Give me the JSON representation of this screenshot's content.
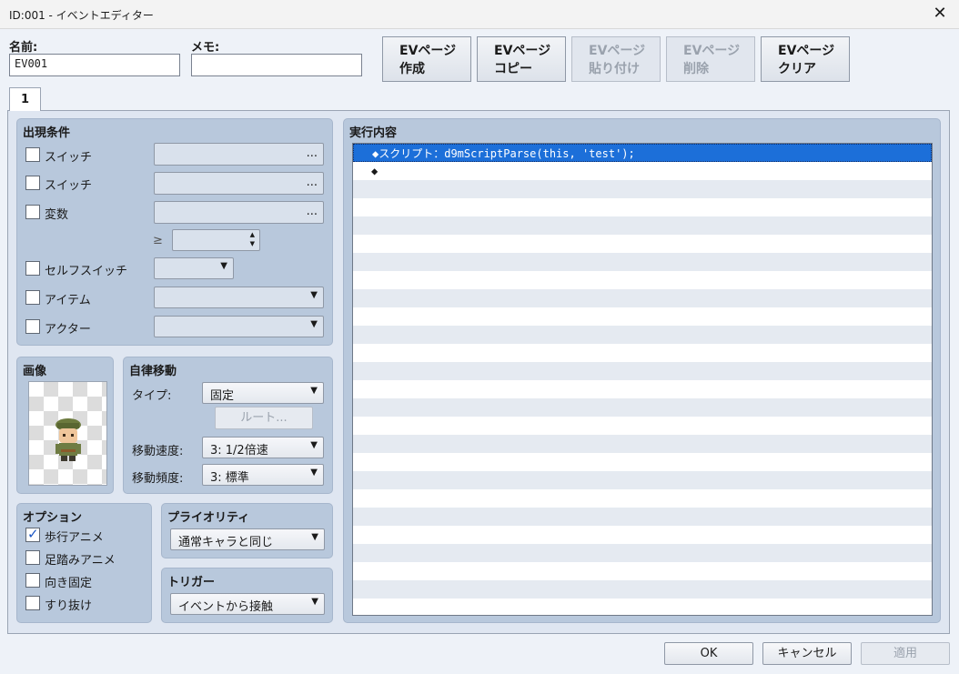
{
  "window": {
    "title": "ID:001 - イベントエディター",
    "close_glyph": "✕"
  },
  "name_label": "名前:",
  "name_value": "EV001",
  "memo_label": "メモ:",
  "memo_value": "",
  "page_buttons": [
    {
      "line1": "EVページ",
      "line2": "作成"
    },
    {
      "line1": "EVページ",
      "line2": "コピー"
    },
    {
      "line1": "EVページ",
      "line2": "貼り付け"
    },
    {
      "line1": "EVページ",
      "line2": "削除"
    },
    {
      "line1": "EVページ",
      "line2": "クリア"
    }
  ],
  "tab_label": "1",
  "conditions": {
    "title": "出現条件",
    "switch1": "スイッチ",
    "switch2": "スイッチ",
    "variable": "変数",
    "ge_symbol": "≥",
    "self_switch": "セルフスイッチ",
    "item": "アイテム",
    "actor": "アクター",
    "dots": "...",
    "arrow": "▼",
    "spin_up": "▲",
    "spin_down": "▼"
  },
  "image_group": {
    "title": "画像"
  },
  "autonomous": {
    "title": "自律移動",
    "type_label": "タイプ:",
    "type_value": "固定",
    "route_button": "ルート...",
    "speed_label": "移動速度:",
    "speed_value": "3: 1/2倍速",
    "freq_label": "移動頻度:",
    "freq_value": "3: 標準"
  },
  "options": {
    "title": "オプション",
    "walking": "歩行アニメ",
    "stepping": "足踏みアニメ",
    "direction_fix": "向き固定",
    "through": "すり抜け"
  },
  "priority": {
    "title": "プライオリティ",
    "value": "通常キャラと同じ"
  },
  "trigger": {
    "title": "トリガー",
    "value": "イベントから接触"
  },
  "contents": {
    "title": "実行内容",
    "lines": [
      "◆スクリプト：d9mScriptParse(this, 'test');",
      "◆"
    ]
  },
  "footer": {
    "ok": "OK",
    "cancel": "キャンセル",
    "apply": "適用"
  },
  "icons": {
    "checkbox_checked": "checkmark-icon",
    "character": "soldier-sprite-icon"
  }
}
